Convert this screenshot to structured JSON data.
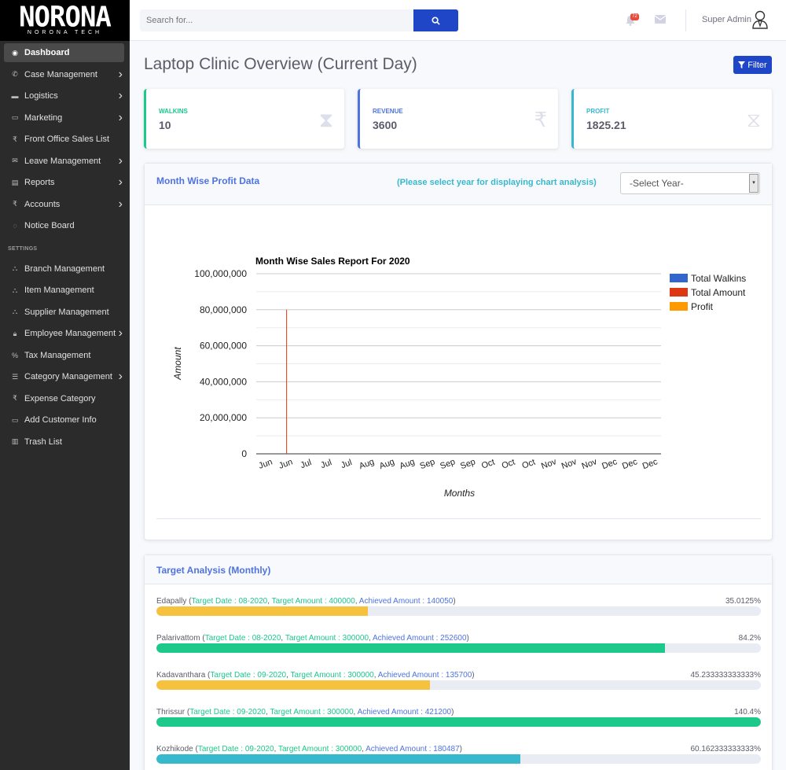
{
  "brand": {
    "name": "NORONA",
    "subtitle": "NORONA TECH"
  },
  "sidebar": {
    "items": [
      {
        "label": "Dashboard",
        "icon": "dashboard-icon",
        "glyph": "◉",
        "chevron": false,
        "active": true
      },
      {
        "label": "Case Management",
        "icon": "phone-icon",
        "glyph": "✆",
        "chevron": true
      },
      {
        "label": "Logistics",
        "icon": "truck-icon",
        "glyph": "▬",
        "chevron": true
      },
      {
        "label": "Marketing",
        "icon": "id-card-icon",
        "glyph": "▭",
        "chevron": true
      },
      {
        "label": "Front Office Sales List",
        "icon": "rupee-icon",
        "glyph": "₹",
        "chevron": false
      },
      {
        "label": "Leave Management",
        "icon": "envelope-open-icon",
        "glyph": "✉",
        "chevron": true
      },
      {
        "label": "Reports",
        "icon": "print-icon",
        "glyph": "▤",
        "chevron": true
      },
      {
        "label": "Accounts",
        "icon": "rupee-icon",
        "glyph": "₹",
        "chevron": true
      },
      {
        "label": "Notice Board",
        "icon": "comment-icon",
        "glyph": "◌",
        "chevron": false
      }
    ],
    "settings_heading": "SETTINGS",
    "settings_items": [
      {
        "label": "Branch Management",
        "icon": "sitemap-icon",
        "glyph": "⛬",
        "chevron": false
      },
      {
        "label": "Item Management",
        "icon": "sitemap-icon",
        "glyph": "⛬",
        "chevron": false
      },
      {
        "label": "Supplier Management",
        "icon": "sitemap-icon",
        "glyph": "⛬",
        "chevron": false
      },
      {
        "label": "Employee Management",
        "icon": "lock-icon",
        "glyph": "🔒︎",
        "chevron": true
      },
      {
        "label": "Tax Management",
        "icon": "percent-icon",
        "glyph": "%",
        "chevron": false
      },
      {
        "label": "Category Management",
        "icon": "list-icon",
        "glyph": "☰",
        "chevron": true
      },
      {
        "label": "Expense Category",
        "icon": "rupee-icon",
        "glyph": "₹",
        "chevron": false
      },
      {
        "label": "Add Customer Info",
        "icon": "laptop-icon",
        "glyph": "▭",
        "chevron": false
      },
      {
        "label": "Trash List",
        "icon": "trash-icon",
        "glyph": "▥",
        "chevron": false
      }
    ]
  },
  "topbar": {
    "search_placeholder": "Search for...",
    "notification_count": "72",
    "user_name": "Super Admin"
  },
  "page": {
    "title": "Laptop Clinic Overview (Current Day)",
    "filter_label": "Filter"
  },
  "stats": [
    {
      "label": "WALKINS",
      "value": "10",
      "color": "#1cc88a",
      "icon": "hourglass-icon",
      "glyph": "⧗"
    },
    {
      "label": "REVENUE",
      "value": "3600",
      "color": "#4e73df",
      "icon": "rupee-icon",
      "glyph": "₹"
    },
    {
      "label": "PROFIT",
      "value": "1825.21",
      "color": "#36b9cc",
      "icon": "hourglass-icon",
      "glyph": "⧖"
    }
  ],
  "profit_card": {
    "title": "Month Wise Profit Data",
    "hint": "(Please select year for displaying chart analysis)",
    "year_select": "-Select Year-"
  },
  "chart_data": {
    "type": "bar",
    "title": "Month Wise Sales Report For 2020",
    "xlabel": "Months",
    "ylabel": "Amount",
    "ylim": [
      0,
      100000000
    ],
    "yticks": [
      "0",
      "20,000,000",
      "40,000,000",
      "60,000,000",
      "80,000,000",
      "100,000,000"
    ],
    "ytick_values": [
      0,
      20000000,
      40000000,
      60000000,
      80000000,
      100000000
    ],
    "categories": [
      "Jun",
      "Jun",
      "Jul",
      "Jul",
      "Jul",
      "Aug",
      "Aug",
      "Aug",
      "Sep",
      "Sep",
      "Sep",
      "Oct",
      "Oct",
      "Oct",
      "Nov",
      "Nov",
      "Nov",
      "Dec",
      "Dec",
      "Dec"
    ],
    "legend_position": "right",
    "series": [
      {
        "name": "Total Walkins",
        "color": "#3366cc",
        "values": [
          0,
          0,
          0,
          0,
          0,
          0,
          0,
          0,
          0,
          0,
          0,
          0,
          0,
          0,
          0,
          0,
          0,
          0,
          0,
          0
        ]
      },
      {
        "name": "Total Amount",
        "color": "#dc3912",
        "values": [
          0,
          80000000,
          0,
          0,
          0,
          0,
          0,
          0,
          0,
          0,
          0,
          0,
          0,
          0,
          0,
          0,
          0,
          0,
          0,
          0
        ]
      },
      {
        "name": "Profit",
        "color": "#ff9900",
        "values": [
          0,
          0,
          0,
          0,
          0,
          0,
          0,
          0,
          0,
          0,
          0,
          0,
          0,
          0,
          0,
          0,
          0,
          0,
          0,
          0
        ]
      }
    ]
  },
  "target_card": {
    "title": "Target Analysis (Monthly)",
    "rows": [
      {
        "branch": "Edapally",
        "target_date": "Target Date : 08-2020",
        "target_amount": "Target Amount : 400000",
        "achieved": "Achieved Amount : 140050",
        "percent": "35.0125%",
        "fill": 0.350125,
        "color": "#f6c23e"
      },
      {
        "branch": "Palarivattom",
        "target_date": "Target Date : 08-2020",
        "target_amount": "Target Amount : 300000",
        "achieved": "Achieved Amount : 252600",
        "percent": "84.2%",
        "fill": 0.842,
        "color": "#1cc88a"
      },
      {
        "branch": "Kadavanthara",
        "target_date": "Target Date : 09-2020",
        "target_amount": "Target Amount : 300000",
        "achieved": "Achieved Amount : 135700",
        "percent": "45.233333333333%",
        "fill": 0.45233,
        "color": "#f6c23e"
      },
      {
        "branch": "Thrissur",
        "target_date": "Target Date : 09-2020",
        "target_amount": "Target Amount : 300000",
        "achieved": "Achieved Amount : 421200",
        "percent": "140.4%",
        "fill": 1.0,
        "color": "#1cc88a"
      },
      {
        "branch": "Kozhikode",
        "target_date": "Target Date : 09-2020",
        "target_amount": "Target Amount : 300000",
        "achieved": "Achieved Amount : 180487",
        "percent": "60.162333333333%",
        "fill": 0.60162,
        "color": "#36b9cc"
      }
    ]
  }
}
